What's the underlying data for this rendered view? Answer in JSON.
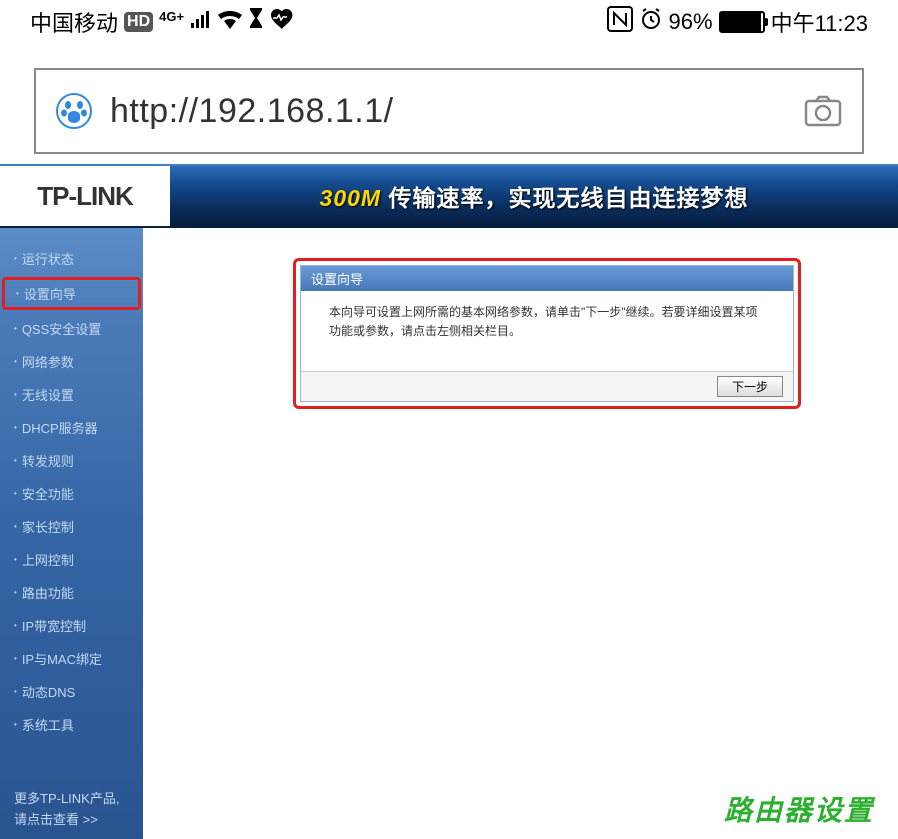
{
  "statusbar": {
    "carrier": "中国移动",
    "hd": "HD",
    "network": "4G+",
    "battery_pct": "96%",
    "time": "中午11:23"
  },
  "addressbar": {
    "url": "http://192.168.1.1/"
  },
  "router_header": {
    "logo": "TP-LINK",
    "banner_speed": "300M",
    "banner_text": " 传输速率，实现无线自由连接梦想"
  },
  "sidebar": {
    "items": [
      "运行状态",
      "设置向导",
      "QSS安全设置",
      "网络参数",
      "无线设置",
      "DHCP服务器",
      "转发规则",
      "安全功能",
      "家长控制",
      "上网控制",
      "路由功能",
      "IP带宽控制",
      "IP与MAC绑定",
      "动态DNS",
      "系统工具"
    ],
    "highlighted_index": 1,
    "footer_line1": "更多TP-LINK产品,",
    "footer_line2": "请点击查看 >>"
  },
  "wizard": {
    "title": "设置向导",
    "body": "本向导可设置上网所需的基本网络参数，请单击\"下一步\"继续。若要详细设置某项功能或参数，请点击左侧相关栏目。",
    "next_label": "下一步"
  },
  "watermark": "路由器设置"
}
